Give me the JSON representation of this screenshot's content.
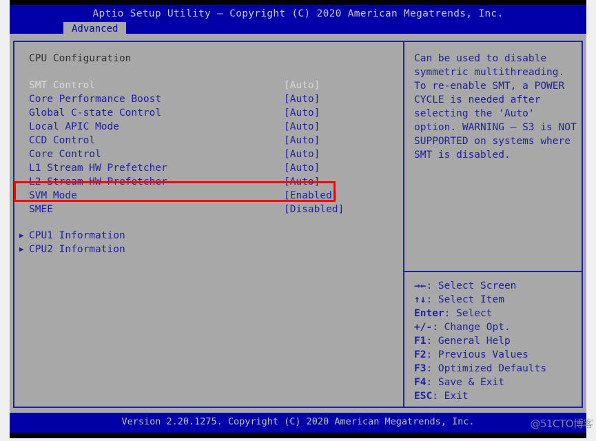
{
  "header": {
    "title": "Aptio Setup Utility – Copyright (C) 2020 American Megatrends, Inc.",
    "active_tab": "Advanced"
  },
  "main": {
    "section_title": "CPU Configuration",
    "options": [
      {
        "label": "SMT Control",
        "value": "[Auto]",
        "state": "dim"
      },
      {
        "label": "Core Performance Boost",
        "value": "[Auto]",
        "state": "normal"
      },
      {
        "label": "Global C-state Control",
        "value": "[Auto]",
        "state": "normal"
      },
      {
        "label": "Local APIC Mode",
        "value": "[Auto]",
        "state": "normal"
      },
      {
        "label": "CCD Control",
        "value": "[Auto]",
        "state": "normal"
      },
      {
        "label": "Core Control",
        "value": "[Auto]",
        "state": "normal"
      },
      {
        "label": "L1 Stream HW Prefetcher",
        "value": "[Auto]",
        "state": "normal"
      },
      {
        "label": "L2 Stream HW Prefetcher",
        "value": "[Auto]",
        "state": "normal"
      },
      {
        "label": "SVM Mode",
        "value": "[Enabled]",
        "state": "normal"
      },
      {
        "label": "SMEE",
        "value": "[Disabled]",
        "state": "normal"
      }
    ],
    "submenus": [
      {
        "arrow": "▶",
        "label": "CPU1 Information"
      },
      {
        "arrow": "▶",
        "label": "CPU2 Information"
      }
    ]
  },
  "help": {
    "text": "Can be used to disable\nsymmetric multithreading.\nTo re-enable SMT, a POWER\nCYCLE is needed after\nselecting the 'Auto'\noption. WARNING – S3 is NOT\nSUPPORTED on systems where\nSMT is disabled."
  },
  "navigation": [
    {
      "key": "→←",
      "desc": ": Select Screen"
    },
    {
      "key": "↑↓",
      "desc": ": Select Item"
    },
    {
      "key": "Enter",
      "desc": ": Select"
    },
    {
      "key": "+/-",
      "desc": ": Change Opt."
    },
    {
      "key": "F1",
      "desc": ": General Help"
    },
    {
      "key": "F2",
      "desc": ": Previous Values"
    },
    {
      "key": "F3",
      "desc": ": Optimized Defaults"
    },
    {
      "key": "F4",
      "desc": ": Save & Exit"
    },
    {
      "key": "ESC",
      "desc": ": Exit"
    }
  ],
  "footer": {
    "version": "Version 2.20.1275. Copyright (C) 2020 American Megatrends, Inc."
  },
  "watermark": {
    "text": "@51CTO博客"
  },
  "colors": {
    "header_blue": "#0000a8",
    "panel_grey": "#a8a8a8",
    "text_blue": "#2020a0",
    "dim_text": "#d8d8d8",
    "annotation_red": "#ff0000"
  }
}
